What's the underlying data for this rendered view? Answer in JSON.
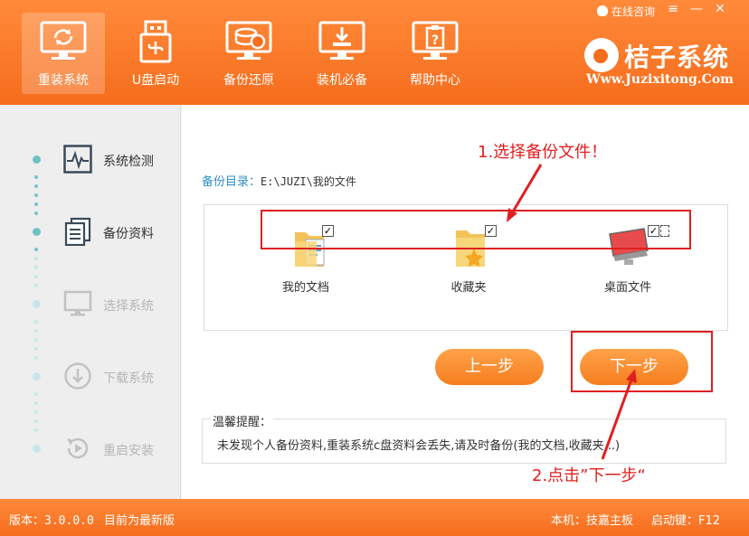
{
  "header": {
    "online_consult": "在线咨询",
    "nav": [
      {
        "label": "重装系统",
        "icon": "reinstall-system-icon",
        "active": true
      },
      {
        "label": "U盘启动",
        "icon": "usb-boot-icon",
        "active": false
      },
      {
        "label": "备份还原",
        "icon": "backup-restore-icon",
        "active": false
      },
      {
        "label": "装机必备",
        "icon": "essential-software-icon",
        "active": false
      },
      {
        "label": "帮助中心",
        "icon": "help-center-icon",
        "active": false
      }
    ],
    "brand_name": "桔子系统",
    "brand_url": "Www.Juzixitong.Com"
  },
  "sidebar": {
    "steps": [
      {
        "label": "系统检测",
        "icon": "system-check-icon",
        "enabled": true
      },
      {
        "label": "备份资料",
        "icon": "backup-data-icon",
        "enabled": true
      },
      {
        "label": "选择系统",
        "icon": "select-system-icon",
        "enabled": false
      },
      {
        "label": "下载系统",
        "icon": "download-system-icon",
        "enabled": false
      },
      {
        "label": "重启安装",
        "icon": "restart-install-icon",
        "enabled": false
      }
    ]
  },
  "main": {
    "backup_dir_label": "备份目录：",
    "backup_dir_path": "E:\\JUZI\\我的文件",
    "files": [
      {
        "label": "我的文档",
        "checked": true,
        "icon": "documents-folder-icon"
      },
      {
        "label": "收藏夹",
        "checked": true,
        "icon": "favorites-folder-icon"
      },
      {
        "label": "桌面文件",
        "checked": true,
        "icon": "desktop-files-icon"
      }
    ],
    "prev_button": "上一步",
    "next_button": "下一步",
    "tip_title": "温馨提醒：",
    "tip_text": "未发现个人备份资料,重装系统c盘资料会丢失,请及时备份(我的文档,收藏夹...)"
  },
  "annotations": {
    "step1": "1.选择备份文件！",
    "step2": "2.点击”下一步“",
    "color": "#e02020"
  },
  "footer": {
    "version_label": "版本：",
    "version": "3.0.0.0",
    "latest": "目前为最新版",
    "board_label": "本机：",
    "board": "技嘉主板",
    "hotkey_label": "启动键：",
    "hotkey": "F12"
  },
  "colors": {
    "accent": "#f56d1d",
    "teal": "#6fc1c4",
    "link": "#2f8fc7"
  }
}
